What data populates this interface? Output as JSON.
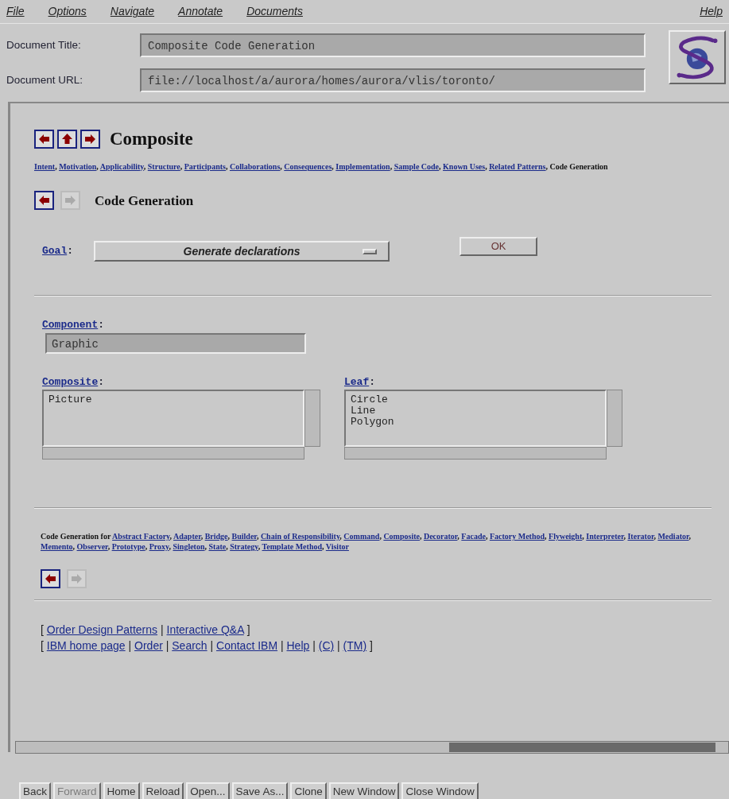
{
  "menu": [
    {
      "label": "File"
    },
    {
      "label": "Options"
    },
    {
      "label": "Navigate"
    },
    {
      "label": "Annotate"
    },
    {
      "label": "Documents"
    }
  ],
  "help_menu": "Help",
  "document_fields": [
    {
      "label": "Document Title:",
      "value": "Composite Code Generation"
    },
    {
      "label": "Document URL:",
      "value": "file://localhost/a/aurora/homes/aurora/vlis/toronto/"
    }
  ],
  "page": {
    "top_nav": [
      {
        "kind": "back",
        "disabled": false
      },
      {
        "kind": "up",
        "disabled": false
      },
      {
        "kind": "forward",
        "disabled": false
      }
    ],
    "heading": "Composite",
    "section_links": [
      {
        "text": "Intent",
        "linked": true,
        "after": ", "
      },
      {
        "text": "Motivation",
        "linked": true,
        "after": ", "
      },
      {
        "text": "Applicability",
        "linked": true,
        "after": ", "
      },
      {
        "text": "Structure",
        "linked": true,
        "after": ", "
      },
      {
        "text": "Participants",
        "linked": true,
        "after": ", "
      },
      {
        "text": "Collaborations",
        "linked": true,
        "after": ", "
      },
      {
        "text": "Consequences",
        "linked": true,
        "after": ", "
      },
      {
        "text": "Implementation",
        "linked": true,
        "after": ", "
      },
      {
        "text": "Sample Code",
        "linked": true,
        "after": ", "
      },
      {
        "text": "Known Uses",
        "linked": true,
        "after": ", "
      },
      {
        "text": "Related Patterns",
        "linked": true,
        "after": ", "
      },
      {
        "text": "Code Generation",
        "linked": false
      }
    ],
    "sub_nav": [
      {
        "kind": "back",
        "disabled": false
      },
      {
        "kind": "forward",
        "disabled": true
      }
    ],
    "subheading": "Code Generation",
    "goal": {
      "label": "Goal",
      "after": ":",
      "value": "Generate declarations"
    },
    "ok_button": "OK",
    "component": {
      "label": "Component",
      "after": ":",
      "value": "Graphic"
    },
    "lists": [
      {
        "label": "Composite",
        "after": ":",
        "items": [
          "Picture"
        ]
      },
      {
        "label": "Leaf",
        "after": ":",
        "items": [
          "Circle",
          "Line",
          "Polygon"
        ]
      }
    ],
    "code_gen_intro": "Code Generation for ",
    "pattern_links": [
      {
        "text": "Abstract Factory",
        "after": ", "
      },
      {
        "text": "Adapter",
        "after": ", "
      },
      {
        "text": "Bridge",
        "after": ", "
      },
      {
        "text": "Builder",
        "after": ", "
      },
      {
        "text": "Chain of Responsibility",
        "after": ", "
      },
      {
        "text": "Command",
        "after": ", "
      },
      {
        "text": "Composite",
        "after": ", "
      },
      {
        "text": "Decorator",
        "after": ", "
      },
      {
        "text": "Facade",
        "after": ", "
      },
      {
        "text": "Factory Method",
        "after": ", "
      },
      {
        "text": "Flyweight",
        "after": ", "
      },
      {
        "text": "Interpreter",
        "after": ", "
      },
      {
        "text": "Iterator",
        "after": ", "
      },
      {
        "text": "Mediator",
        "after": ", "
      },
      {
        "text": "Memento",
        "after": ", "
      },
      {
        "text": "Observer",
        "after": ", "
      },
      {
        "text": "Prototype",
        "after": ", "
      },
      {
        "text": "Proxy",
        "after": ", "
      },
      {
        "text": "Singleton",
        "after": ", "
      },
      {
        "text": "State",
        "after": ", "
      },
      {
        "text": "Strategy",
        "after": ", "
      },
      {
        "text": "Template Method",
        "after": ", "
      },
      {
        "text": "Visitor"
      }
    ],
    "bottom_nav": [
      {
        "kind": "back",
        "disabled": false
      },
      {
        "kind": "forward",
        "disabled": true
      }
    ],
    "footer_lines": [
      {
        "open": "[ ",
        "links": [
          {
            "text": "Order Design Patterns",
            "after": " | "
          },
          {
            "text": "Interactive Q&A"
          }
        ],
        "close": " ]"
      },
      {
        "open": "[ ",
        "links": [
          {
            "text": "IBM home page",
            "after": " | "
          },
          {
            "text": "Order",
            "after": " | "
          },
          {
            "text": "Search",
            "after": " | "
          },
          {
            "text": "Contact IBM",
            "after": " | "
          },
          {
            "text": "Help",
            "after": " | "
          },
          {
            "text": "(C)",
            "after": " | "
          },
          {
            "text": "(TM)"
          }
        ],
        "close": " ]"
      }
    ]
  },
  "toolbar": [
    {
      "label": "Back",
      "disabled": false
    },
    {
      "label": "Forward",
      "disabled": true
    },
    {
      "label": "Home",
      "disabled": false
    },
    {
      "label": "Reload",
      "disabled": false
    },
    {
      "label": "Open...",
      "disabled": false
    },
    {
      "label": "Save As...",
      "disabled": false
    },
    {
      "label": "Clone",
      "disabled": false
    },
    {
      "label": "New Window",
      "disabled": false
    },
    {
      "label": "Close Window",
      "disabled": false
    }
  ]
}
